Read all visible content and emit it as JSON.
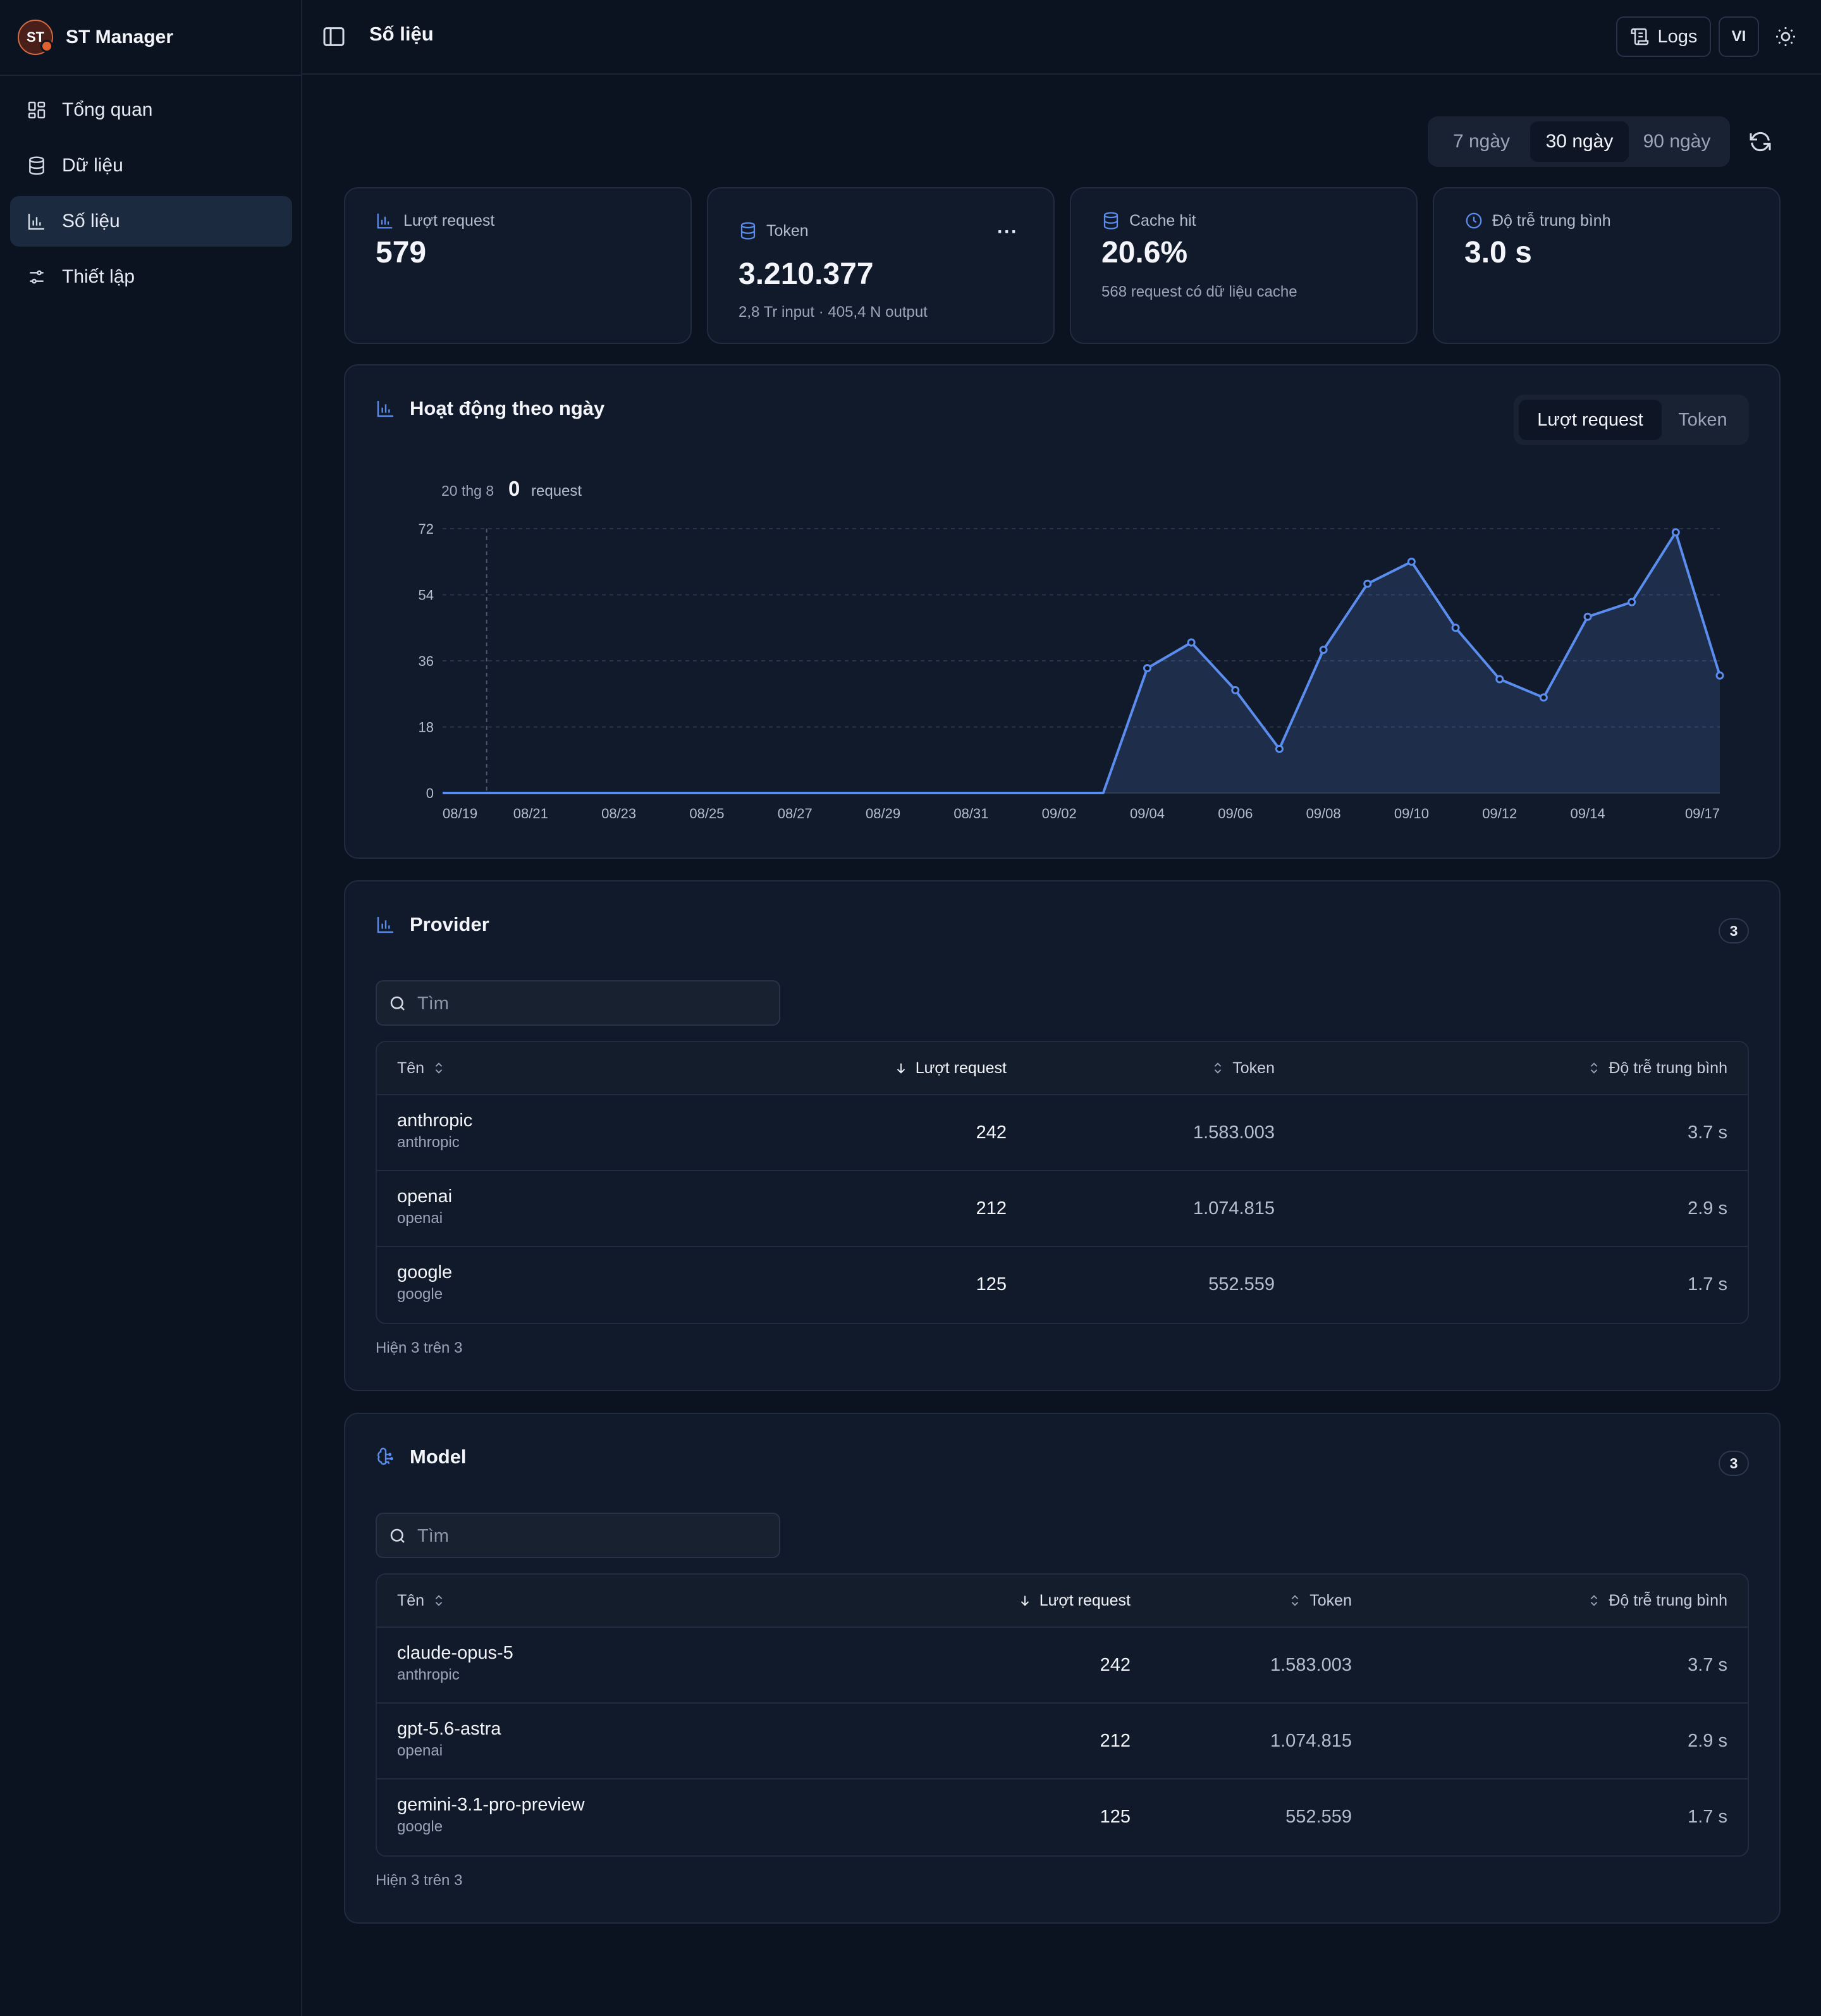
{
  "app": {
    "logo_text": "ST",
    "name": "ST Manager"
  },
  "sidebar": {
    "items": [
      {
        "label": "Tổng quan",
        "icon": "dashboard-icon"
      },
      {
        "label": "Dữ liệu",
        "icon": "database-icon"
      },
      {
        "label": "Số liệu",
        "icon": "bar-chart-icon",
        "active": true
      },
      {
        "label": "Thiết lập",
        "icon": "settings-sliders-icon"
      }
    ]
  },
  "header": {
    "title": "Số liệu",
    "logs_label": "Logs",
    "language": "VI"
  },
  "range": {
    "options": [
      "7 ngày",
      "30 ngày",
      "90 ngày"
    ],
    "selected": "30 ngày"
  },
  "stats": {
    "requests": {
      "label": "Lượt request",
      "value": "579"
    },
    "tokens": {
      "label": "Token",
      "value": "3.210.377",
      "sub": "2,8 Tr input · 405,4 N output",
      "more": "···"
    },
    "cache": {
      "label": "Cache hit",
      "value": "20.6%",
      "sub": "568 request có dữ liệu cache"
    },
    "latency": {
      "label": "Độ trễ trung bình",
      "value": "3.0 s"
    }
  },
  "activity": {
    "title": "Hoạt động theo ngày",
    "toggle": {
      "options": [
        "Lượt request",
        "Token"
      ],
      "selected": "Lượt request"
    },
    "tooltip": {
      "date": "20 thg 8",
      "value": "0",
      "unit": "request"
    }
  },
  "chart_data": {
    "type": "area",
    "title": "Hoạt động theo ngày",
    "x": [
      "08/19",
      "08/20",
      "08/21",
      "08/22",
      "08/23",
      "08/24",
      "08/25",
      "08/26",
      "08/27",
      "08/28",
      "08/29",
      "08/30",
      "08/31",
      "09/01",
      "09/02",
      "09/03",
      "09/04",
      "09/05",
      "09/06",
      "09/07",
      "09/08",
      "09/09",
      "09/10",
      "09/11",
      "09/12",
      "09/13",
      "09/14",
      "09/15",
      "09/16",
      "09/17"
    ],
    "x_tick_labels": [
      "08/19",
      "08/21",
      "08/23",
      "08/25",
      "08/27",
      "08/29",
      "08/31",
      "09/02",
      "09/04",
      "09/06",
      "09/08",
      "09/10",
      "09/12",
      "09/14",
      "09/17"
    ],
    "series": [
      {
        "values": [
          0,
          0,
          0,
          0,
          0,
          0,
          0,
          0,
          0,
          0,
          0,
          0,
          0,
          0,
          0,
          0,
          34,
          41,
          28,
          12,
          39,
          57,
          63,
          45,
          31,
          26,
          48,
          52,
          71,
          32
        ]
      }
    ],
    "y_ticks": [
      0,
      18,
      36,
      54,
      72
    ],
    "ylim": [
      0,
      72
    ],
    "grid": true,
    "highlight_x": "08/20",
    "color": "#5b8def"
  },
  "provider": {
    "title": "Provider",
    "count": "3",
    "search_placeholder": "Tìm",
    "columns": [
      "Tên",
      "Lượt request",
      "Token",
      "Độ trễ trung bình"
    ],
    "rows": [
      {
        "name": "anthropic",
        "sub": "anthropic",
        "requests": "242",
        "tokens": "1.583.003",
        "latency": "3.7 s"
      },
      {
        "name": "openai",
        "sub": "openai",
        "requests": "212",
        "tokens": "1.074.815",
        "latency": "2.9 s"
      },
      {
        "name": "google",
        "sub": "google",
        "requests": "125",
        "tokens": "552.559",
        "latency": "1.7 s"
      }
    ],
    "footer": "Hiện 3 trên 3"
  },
  "model": {
    "title": "Model",
    "count": "3",
    "search_placeholder": "Tìm",
    "columns": [
      "Tên",
      "Lượt request",
      "Token",
      "Độ trễ trung bình"
    ],
    "rows": [
      {
        "name": "claude-opus-5",
        "sub": "anthropic",
        "requests": "242",
        "tokens": "1.583.003",
        "latency": "3.7 s"
      },
      {
        "name": "gpt-5.6-astra",
        "sub": "openai",
        "requests": "212",
        "tokens": "1.074.815",
        "latency": "2.9 s"
      },
      {
        "name": "gemini-3.1-pro-preview",
        "sub": "google",
        "requests": "125",
        "tokens": "552.559",
        "latency": "1.7 s"
      }
    ],
    "footer": "Hiện 3 trên 3"
  },
  "colors": {
    "accent": "#5b8def",
    "background": "#0b1220",
    "card": "#111a2a",
    "brand": "#e0612f"
  }
}
